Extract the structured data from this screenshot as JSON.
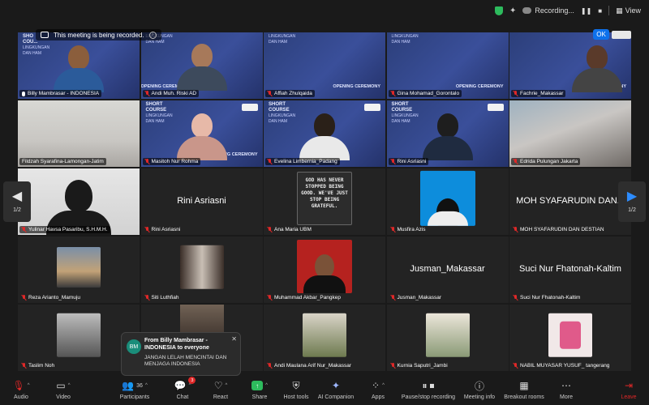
{
  "topbar": {
    "recording_label": "Recording...",
    "view_label": "View"
  },
  "recording_banner": {
    "text": "This meeting is being recorded.",
    "ok_label": "OK"
  },
  "banner_text": {
    "line1": "SHORT",
    "line2": "COURSE",
    "line3": "LINGKUNGAN",
    "line4": "DAN HAM",
    "ceremony": "OPENING CEREMONY",
    "top_left_short": "SHO",
    "top_left_cou": "COU..."
  },
  "participants": [
    {
      "name": "Billy Mambrasar - INDONESIA",
      "muted": false
    },
    {
      "name": "Andi Muh. Riski AD",
      "muted": true
    },
    {
      "name": "Affiah Zhulqaida",
      "muted": true
    },
    {
      "name": "Gina Mohamad_Gorontalo",
      "muted": true
    },
    {
      "name": "Fachrie_Makassar",
      "muted": true
    },
    {
      "name": "Fildzah Syarafina-Lamongan-Jatim",
      "muted": false
    },
    {
      "name": "Masitoh Nur Rohma",
      "muted": true
    },
    {
      "name": "Evelina Limbernia_Padang",
      "muted": true
    },
    {
      "name": "Rini Asriasni",
      "muted": true
    },
    {
      "name": "Edrida Pulungan Jakarta",
      "muted": true
    },
    {
      "name": "Yulinar Havsa Pasaribu, S.H.M.H.",
      "muted": true
    },
    {
      "name": "Rini Asriasni",
      "muted": true,
      "display_name": "Rini Asriasni"
    },
    {
      "name": "Ana Maria UBM",
      "muted": true
    },
    {
      "name": "Musfira Azis",
      "muted": true
    },
    {
      "name": "MOH SYAFARUDIN DAN DESTIAN",
      "muted": true,
      "display_name": "MOH SYAFARUDIN DAN..."
    },
    {
      "name": "Reza Arianto_Mamuju",
      "muted": true
    },
    {
      "name": "Siti Luthfiah",
      "muted": true
    },
    {
      "name": "Muhammad Akbar_Pangkep",
      "muted": true
    },
    {
      "name": "Jusman_Makassar",
      "muted": true,
      "display_name": "Jusman_Makassar"
    },
    {
      "name": "MOH SYAFARUDIN DAN DESTIAN",
      "muted": true,
      "display_name": "Suci Nur Fhatonah-Kaltim",
      "label": "Suci Nur Fhatonah-Kaltim"
    },
    {
      "name": "Taslim Noh",
      "muted": true
    },
    {
      "name": "",
      "muted": true
    },
    {
      "name": "Andi Maulana Arif Nur_Makassar",
      "muted": true
    },
    {
      "name": "Kurnia Saputri_Jambi",
      "muted": true
    },
    {
      "name": "NABIL MUYASAR YUSUF_ tangerang",
      "muted": true
    }
  ],
  "sign_text": "GOD HAS NEVER STOPPED BEING GOOD. WE'VE JUST STOP BEING GRATEFUL.",
  "pager": {
    "left_page": "1/2",
    "right_page": "1/2"
  },
  "chat": {
    "avatar_initials": "BM",
    "from": "From Billy Mambrasar - INDONESIA to everyone",
    "message": "JANGAN LELAH MENCINTAI DAN MENJAGA INDONESIA"
  },
  "toolbar": {
    "audio": "Audio",
    "video": "Video",
    "participants": "Participants",
    "participants_count": "36",
    "chat": "Chat",
    "chat_badge": "3",
    "react": "React",
    "share": "Share",
    "host_tools": "Host tools",
    "ai_companion": "AI Companion",
    "apps": "Apps",
    "pause_stop_recording": "Pause/stop recording",
    "meeting_info": "Meeting info",
    "breakout_rooms": "Breakout rooms",
    "more": "More",
    "leave": "Leave"
  },
  "colors": {
    "accent_blue": "#0e71eb",
    "active_speaker": "#2dbb5d",
    "muted_red": "#e02828",
    "banner_blue": "#2c3f7a"
  }
}
